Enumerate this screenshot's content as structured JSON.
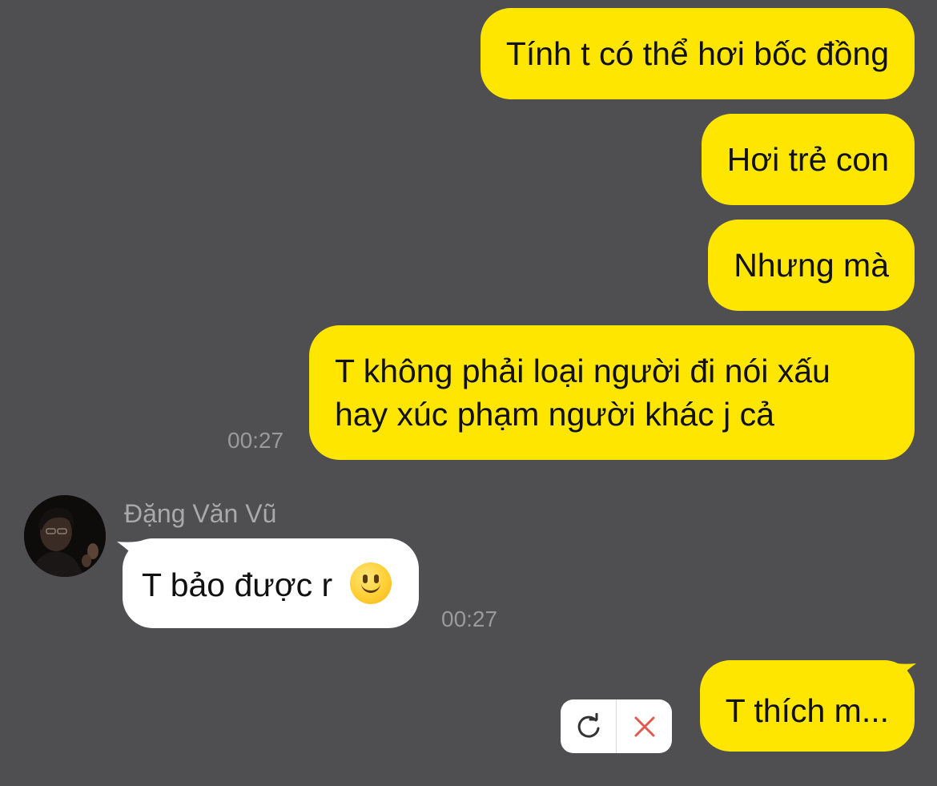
{
  "colors": {
    "background": "#4f4e50",
    "outgoing_bubble": "#ffe600",
    "incoming_bubble": "#ffffff",
    "timestamp": "#9a9a9a",
    "sender_name": "#a9a9a9",
    "cancel_icon": "#e05a4e"
  },
  "messages": {
    "out1": "Tính t có thể hơi bốc đồng",
    "out2": "Hơi trẻ con",
    "out3": "Nhưng mà",
    "out4_line1": "T không phải loại người đi nói xấu",
    "out4_line2": "hay xúc phạm người khác j cả",
    "out4_time": "00:27",
    "in1_sender": "Đặng Văn Vũ",
    "in1_text": "T bảo được r",
    "in1_emoji": "slightly-smiling-face-emoji",
    "in1_time": "00:27",
    "out5_pending": "T thích m..."
  },
  "pending_actions": {
    "retry_icon": "refresh-icon",
    "cancel_icon": "close-icon"
  }
}
